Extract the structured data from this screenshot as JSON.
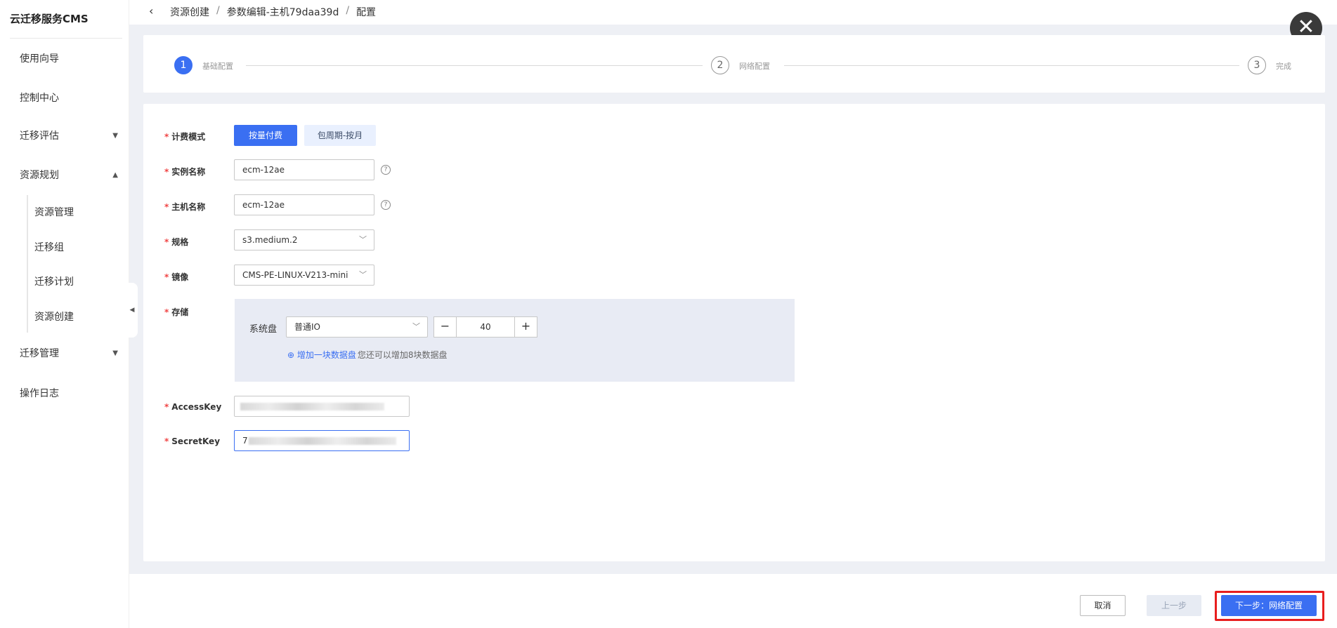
{
  "sidebar": {
    "brand": "云迁移服务CMS",
    "items": [
      {
        "label": "使用向导"
      },
      {
        "label": "控制中心"
      },
      {
        "label": "迁移评估"
      },
      {
        "label": "资源规划"
      },
      {
        "label": "迁移管理"
      },
      {
        "label": "操作日志"
      }
    ],
    "sub_items": [
      {
        "label": "资源管理"
      },
      {
        "label": "迁移组"
      },
      {
        "label": "迁移计划"
      },
      {
        "label": "资源创建"
      }
    ]
  },
  "breadcrumb": {
    "items": [
      "资源创建",
      "参数编辑-主机79daa39d",
      "配置"
    ],
    "separator": "/"
  },
  "steps": [
    {
      "num": "1",
      "label": "基础配置",
      "state": "active"
    },
    {
      "num": "2",
      "label": "网络配置",
      "state": "pending"
    },
    {
      "num": "3",
      "label": "完成",
      "state": "pending"
    }
  ],
  "form": {
    "billing": {
      "label": "计费模式",
      "options": [
        "按量付费",
        "包周期-按月"
      ],
      "selected": "按量付费"
    },
    "instance_name": {
      "label": "实例名称",
      "value": "ecm-12ae"
    },
    "host_name": {
      "label": "主机名称",
      "value": "ecm-12ae"
    },
    "spec": {
      "label": "规格",
      "value": "s3.medium.2"
    },
    "image": {
      "label": "镜像",
      "value": "CMS-PE-LINUX-V213-mini"
    },
    "storage": {
      "label": "存储",
      "system_disk_label": "系统盘",
      "disk_type": "普通IO",
      "size": "40",
      "add_link": "增加一块数据盘",
      "add_hint": "您还可以增加8块数据盘"
    },
    "access_key": {
      "label": "AccessKey",
      "value": ""
    },
    "secret_key": {
      "label": "SecretKey",
      "value": "7"
    }
  },
  "footer": {
    "cancel": "取消",
    "prev": "上一步",
    "next": "下一步：网络配置"
  },
  "colors": {
    "primary": "#3a6ff2",
    "required": "#f04444",
    "highlight": "#e81e1e"
  }
}
